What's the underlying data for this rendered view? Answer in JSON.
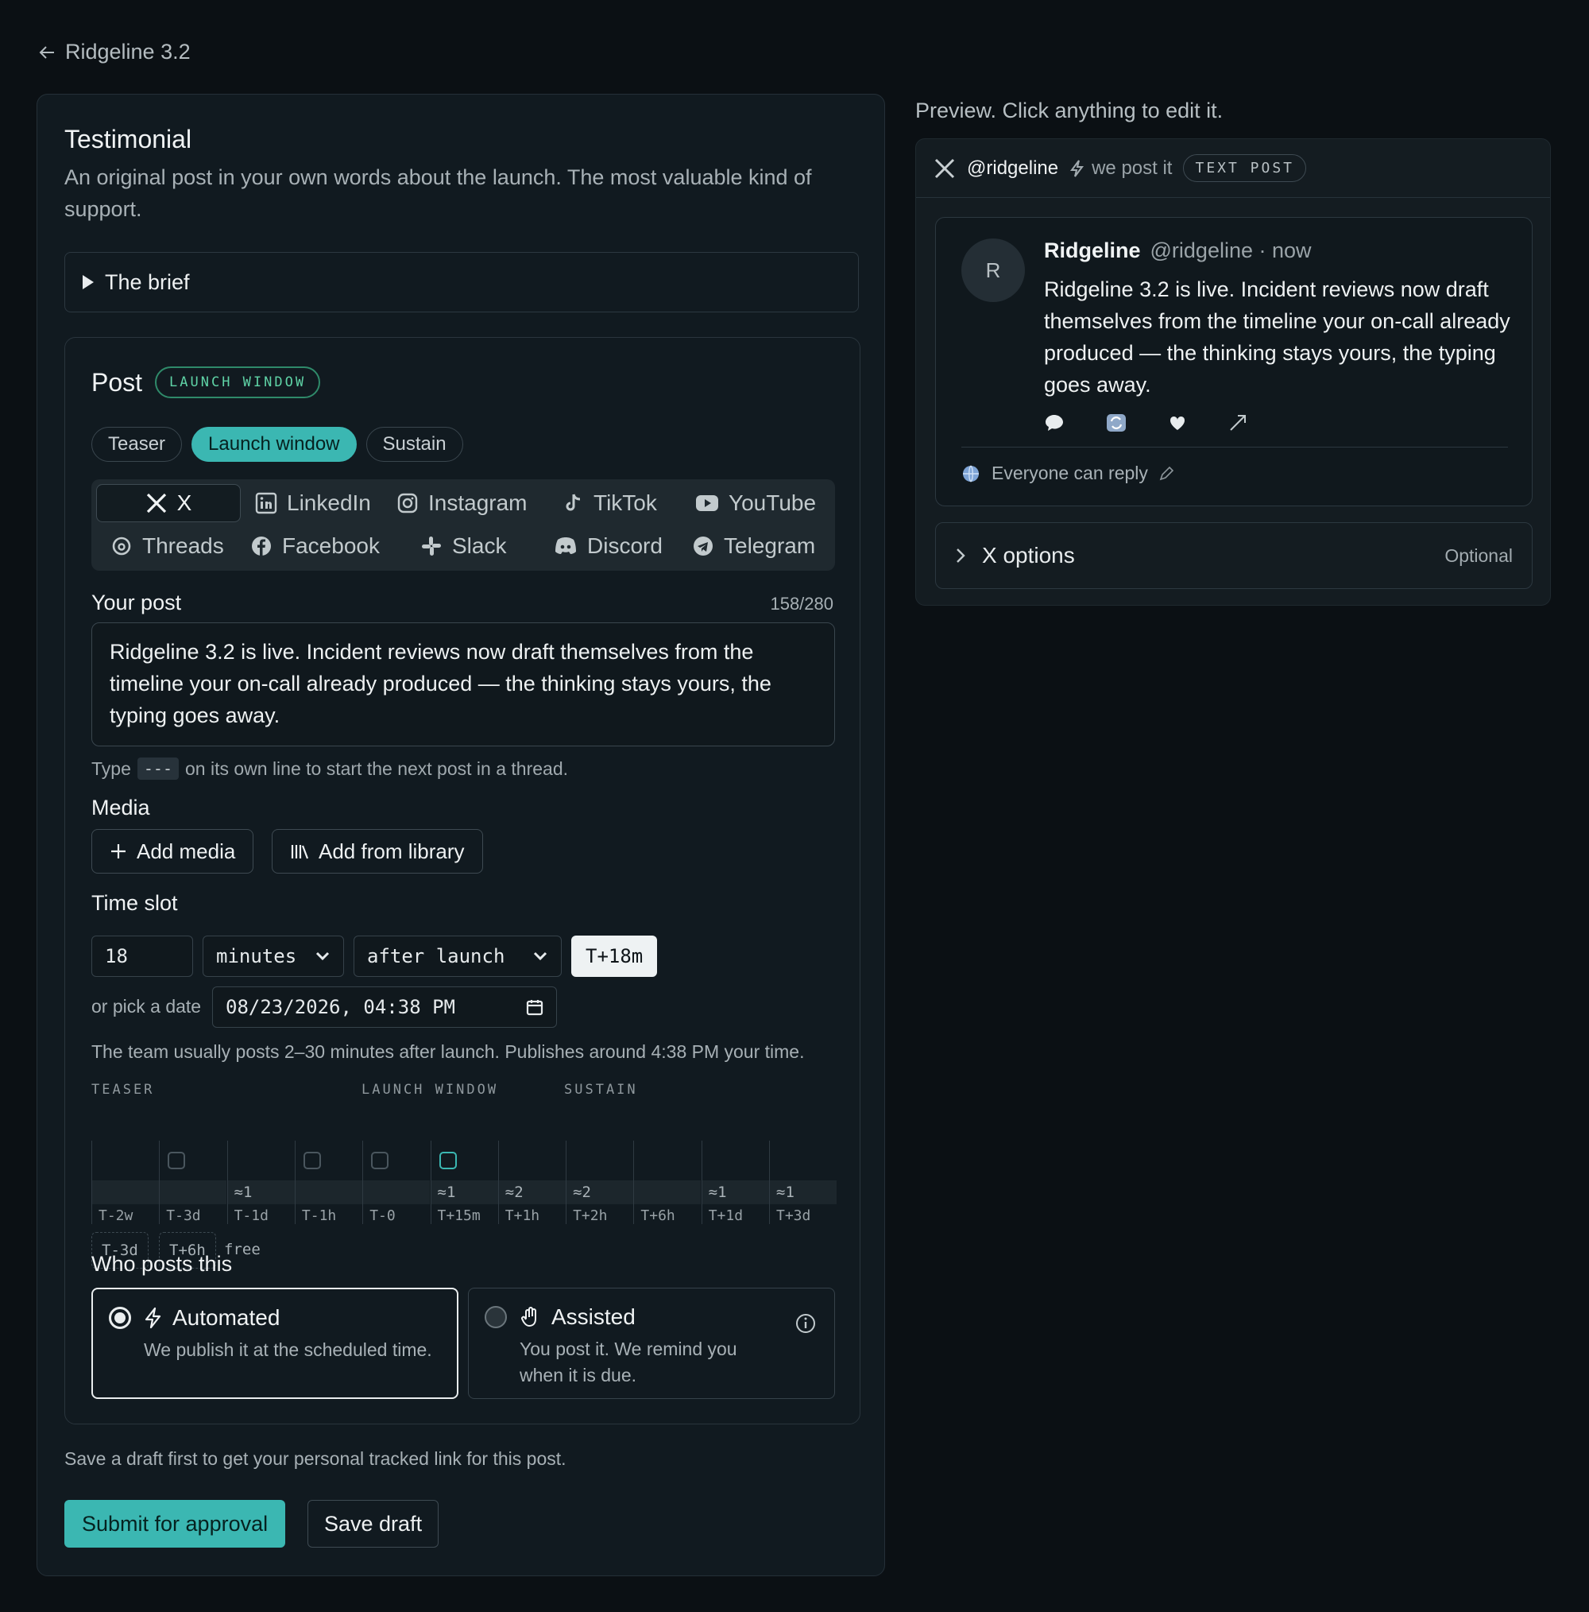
{
  "nav": {
    "back_label": "Ridgeline 3.2"
  },
  "section": {
    "title": "Testimonial",
    "description": "An original post in your own words about the launch. The most valuable kind of support.",
    "brief_label": "The brief"
  },
  "post": {
    "title": "Post",
    "badge": "LAUNCH WINDOW",
    "phases": [
      "Teaser",
      "Launch window",
      "Sustain"
    ],
    "platforms": {
      "x": "X",
      "linkedin": "LinkedIn",
      "instagram": "Instagram",
      "tiktok": "TikTok",
      "youtube": "YouTube",
      "threads": "Threads",
      "facebook": "Facebook",
      "slack": "Slack",
      "discord": "Discord",
      "telegram": "Telegram"
    },
    "your_post_label": "Your post",
    "counter": "158/280",
    "body": "Ridgeline 3.2 is live. Incident reviews now draft themselves from the timeline your on-call already produced — the thinking stays yours, the typing goes away.",
    "hint_before": "Type",
    "hint_code": "---",
    "hint_after": "on its own line to start the next post in a thread.",
    "media_label": "Media",
    "add_media": "Add media",
    "add_library": "Add from library",
    "timeslot_label": "Time slot",
    "offset_value": "18",
    "unit": "minutes",
    "relation": "after launch",
    "offset_chip": "T+18m",
    "pick_date_label": "or pick a date",
    "date_value": "08/23/2026, 04:38 PM",
    "timing_note": "The team usually posts 2–30 minutes after launch. Publishes around 4:38 PM your time.",
    "timeline": {
      "headers": {
        "teaser": "TEASER",
        "launch": "LAUNCH WINDOW",
        "sustain": "SUSTAIN"
      },
      "cols": [
        {
          "label": "T-2w",
          "count": "",
          "box": "none"
        },
        {
          "label": "T-3d",
          "count": "",
          "box": "off"
        },
        {
          "label": "T-1d",
          "count": "≈1",
          "box": "none"
        },
        {
          "label": "T-1h",
          "count": "",
          "box": "off"
        },
        {
          "label": "T-0",
          "count": "",
          "box": "off"
        },
        {
          "label": "T+15m",
          "count": "≈1",
          "box": "on"
        },
        {
          "label": "T+1h",
          "count": "≈2",
          "box": "none"
        },
        {
          "label": "T+2h",
          "count": "≈2",
          "box": "none"
        },
        {
          "label": "T+6h",
          "count": "",
          "box": "none"
        },
        {
          "label": "T+1d",
          "count": "≈1",
          "box": "none"
        },
        {
          "label": "T+3d",
          "count": "≈1",
          "box": "none"
        }
      ],
      "free_slots": [
        "T-3d",
        "T+6h"
      ],
      "free_label": "free"
    },
    "who_label": "Who posts this",
    "automated_title": "Automated",
    "automated_desc": "We publish it at the scheduled time.",
    "assisted_title": "Assisted",
    "assisted_desc_1": "You post it. We remind you",
    "assisted_desc_2": "when it is due."
  },
  "footer": {
    "note": "Save a draft first to get your personal tracked link for this post.",
    "submit": "Submit for approval",
    "save": "Save draft"
  },
  "preview": {
    "title": "Preview. Click anything to edit it.",
    "handle": "@ridgeline",
    "mode": "we post it",
    "type_tag": "TEXT POST",
    "avatar_letter": "R",
    "name": "Ridgeline",
    "meta": "@ridgeline · now",
    "body": "Ridgeline 3.2 is live. Incident reviews now draft themselves from the timeline your on-call already produced — the thinking stays yours, the typing goes away.",
    "reply": "Everyone can reply",
    "x_options": "X options",
    "optional": "Optional"
  },
  "colors": {
    "accent": "#3bb7b2",
    "badge_green": "#5fd3a6",
    "background": "#0b1014",
    "panel": "#111a20"
  }
}
